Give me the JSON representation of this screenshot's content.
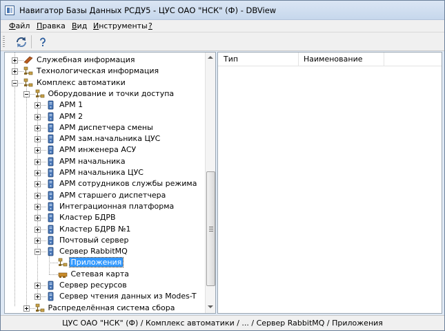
{
  "window": {
    "title": "Навигатор Базы Данных РСДУ5 - ЦУС ОАО \"НСК\" (Ф) - DBView"
  },
  "menu": [
    {
      "u": "Ф",
      "rest": "айл"
    },
    {
      "u": "П",
      "rest": "равка"
    },
    {
      "u": "В",
      "rest": "ид"
    },
    {
      "u": "И",
      "rest": "нструменты"
    },
    {
      "u": "?",
      "rest": ""
    }
  ],
  "toolbar": {
    "buttons": [
      "refresh-icon",
      "help-icon"
    ]
  },
  "tree": {
    "nodes": [
      {
        "label": "Служебная информация",
        "icon": "book-icon",
        "expander": "plus"
      },
      {
        "label": "Технологическая информация",
        "icon": "network-icon",
        "expander": "plus"
      },
      {
        "label": "Комплекс автоматики",
        "icon": "network-icon",
        "expander": "minus"
      },
      {
        "label": "Оборудование и точки доступа",
        "icon": "network-icon",
        "expander": "minus"
      },
      {
        "label": "АРМ 1",
        "icon": "computer-icon",
        "expander": "plus"
      },
      {
        "label": "АРМ 2",
        "icon": "computer-icon",
        "expander": "plus"
      },
      {
        "label": "АРМ диспетчера смены",
        "icon": "computer-icon",
        "expander": "plus"
      },
      {
        "label": "АРМ зам.начальника ЦУС",
        "icon": "computer-icon",
        "expander": "plus"
      },
      {
        "label": "АРМ инженера АСУ",
        "icon": "computer-icon",
        "expander": "plus"
      },
      {
        "label": "АРМ начальника",
        "icon": "computer-icon",
        "expander": "plus"
      },
      {
        "label": "АРМ начальника ЦУС",
        "icon": "computer-icon",
        "expander": "plus"
      },
      {
        "label": "АРМ сотрудников службы режима",
        "icon": "computer-icon",
        "expander": "plus"
      },
      {
        "label": "АРМ старшего диспетчера",
        "icon": "computer-icon",
        "expander": "plus"
      },
      {
        "label": "Интеграционная платформа",
        "icon": "computer-icon",
        "expander": "plus"
      },
      {
        "label": "Кластер БДРВ",
        "icon": "computer-icon",
        "expander": "plus"
      },
      {
        "label": "Кластер БДРВ №1",
        "icon": "computer-icon",
        "expander": "plus"
      },
      {
        "label": "Почтовый сервер",
        "icon": "computer-icon",
        "expander": "plus"
      },
      {
        "label": "Сервер RabbitMQ",
        "icon": "computer-icon",
        "expander": "minus"
      },
      {
        "label": "Приложения",
        "icon": "network-icon",
        "expander": "none",
        "selected": true
      },
      {
        "label": "Сетевая карта",
        "icon": "network-card-icon",
        "expander": "none"
      },
      {
        "label": "Сервер ресурсов",
        "icon": "computer-icon",
        "expander": "plus"
      },
      {
        "label": "Сервер чтения данных из Modes-T",
        "icon": "computer-icon",
        "expander": "plus"
      },
      {
        "label": "Распределённая система сбора",
        "icon": "network-icon",
        "expander": "plus"
      }
    ]
  },
  "list": {
    "columns": [
      "Тип",
      "Наименование"
    ]
  },
  "status": {
    "path": "ЦУС ОАО \"НСК\" (Ф) / Комплекс автоматики / ... / Сервер RabbitMQ / Приложения"
  },
  "colors": {
    "selection": "#3399ff",
    "titlebar": "#c6d7ec"
  }
}
